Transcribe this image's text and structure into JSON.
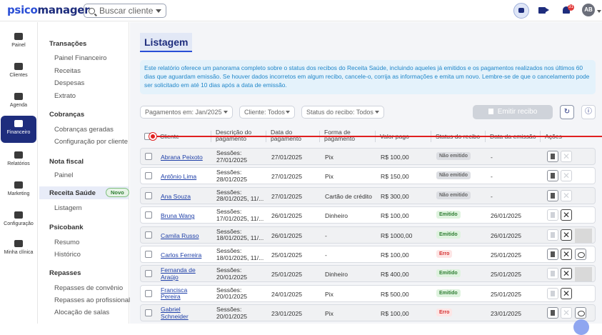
{
  "header": {
    "logo_prefix": "psico",
    "logo_suffix": "manager",
    "search_placeholder": "Buscar cliente",
    "notification_count": "31",
    "avatar_initials": "AB"
  },
  "rail": [
    {
      "label": "Painel",
      "icon": "speedometer-icon"
    },
    {
      "label": "Clientes",
      "icon": "users-icon"
    },
    {
      "label": "Agenda",
      "icon": "calendar-icon"
    },
    {
      "label": "Financeiro",
      "icon": "money-icon",
      "active": true
    },
    {
      "label": "Relatórios",
      "icon": "report-icon"
    },
    {
      "label": "Marketing",
      "icon": "megaphone-icon"
    },
    {
      "label": "Configuração",
      "icon": "gear-icon"
    },
    {
      "label": "Minha clínica",
      "icon": "building-icon"
    }
  ],
  "submenu": {
    "transacoes": "Transações",
    "painel_financeiro": "Painel Financeiro",
    "receitas": "Receitas",
    "despesas": "Despesas",
    "extrato": "Extrato",
    "cobrancas": "Cobranças",
    "cobrancas_geradas": "Cobranças geradas",
    "config_cliente": "Configuração por cliente",
    "nota_fiscal": "Nota fiscal",
    "nf_painel": "Painel",
    "receita_saude": "Receita Saúde",
    "novo_badge": "Novo",
    "listagem": "Listagem",
    "psicobank": "Psicobank",
    "resumo": "Resumo",
    "historico": "Histórico",
    "repasses": "Repasses",
    "repasses_convenio": "Repasses de convênio",
    "repasses_profissional": "Repasses ao profissional",
    "alocacao_salas": "Alocação de salas"
  },
  "main": {
    "title": "Listagem",
    "info": "Este relatório oferece um panorama completo sobre o status dos recibos do Receita Saúde, incluindo aqueles já emitidos e os pagamentos realizados nos últimos 60 dias que aguardam emissão. Se houver dados incorretos em algum recibo, cancele-o, corrija as informações e emita um novo. Lembre-se de que o cancelamento pode ser solicitado em até 10 dias após a data de emissão.",
    "filter_payments": "Pagamentos em: Jan/2025",
    "filter_client": "Cliente: Todos",
    "filter_status": "Status do recibo: Todos",
    "emit_button": "Emitir recibo"
  },
  "table": {
    "headers": [
      "Cliente",
      "Descrição do pagamento",
      "Data do pagamento",
      "Forma de pagamento",
      "Valor pago",
      "Status do recibo",
      "Data da emissão",
      "Ações"
    ],
    "rows": [
      {
        "cliente": "Abrana Peixoto",
        "desc1": "Sessões:",
        "desc2": "27/01/2025",
        "data": "27/01/2025",
        "forma": "Pix",
        "valor": "R$ 100,00",
        "status": "Não emitido",
        "emissao": "-"
      },
      {
        "cliente": "Antônio Lima",
        "desc1": "Sessões:",
        "desc2": "28/01/2025",
        "data": "27/01/2025",
        "forma": "Pix",
        "valor": "R$ 150,00",
        "status": "Não emitido",
        "emissao": "-"
      },
      {
        "cliente": "Ana Souza",
        "desc1": "Sessões:",
        "desc2": "28/01/2025, 11/...",
        "data": "27/01/2025",
        "forma": "Cartão de crédito",
        "valor": "R$ 300,00",
        "status": "Não emitido",
        "emissao": "-"
      },
      {
        "cliente": "Bruna Wang",
        "desc1": "Sessões:",
        "desc2": "17/01/2025, 11/...",
        "data": "26/01/2025",
        "forma": "Dinheiro",
        "valor": "R$ 100,00",
        "status": "Emitido",
        "emissao": "26/01/2025"
      },
      {
        "cliente": "Camila Russo",
        "desc1": "Sessões:",
        "desc2": "18/01/2025, 11/...",
        "data": "26/01/2025",
        "forma": "-",
        "valor": "R$ 1000,00",
        "status": "Emitido",
        "emissao": "26/01/2025"
      },
      {
        "cliente": "Carlos Ferreira",
        "desc1": "Sessões:",
        "desc2": "18/01/2025, 11/...",
        "data": "25/01/2025",
        "forma": "-",
        "valor": "R$ 100,00",
        "status": "Erro",
        "emissao": "25/01/2025"
      },
      {
        "cliente": "Fernanda de Araújo",
        "desc1": "Sessões:",
        "desc2": "20/01/2025",
        "data": "25/01/2025",
        "forma": "Dinheiro",
        "valor": "R$ 400,00",
        "status": "Emitido",
        "emissao": "25/01/2025"
      },
      {
        "cliente": "Francisca Pereira",
        "desc1": "Sessões:",
        "desc2": "20/01/2025",
        "data": "24/01/2025",
        "forma": "Pix",
        "valor": "R$ 500,00",
        "status": "Emitido",
        "emissao": "25/01/2025"
      },
      {
        "cliente": "Gabriel Schneider",
        "desc1": "Sessões:",
        "desc2": "20/01/2025",
        "data": "23/01/2025",
        "forma": "Pix",
        "valor": "R$ 100,00",
        "status": "Erro",
        "emissao": "23/01/2025"
      }
    ]
  },
  "colors": {
    "brand": "#1e2d7d",
    "accent": "#2b4fd6",
    "info_text": "#1f86c9",
    "error": "#d32f2f",
    "success": "#2e7d32"
  }
}
